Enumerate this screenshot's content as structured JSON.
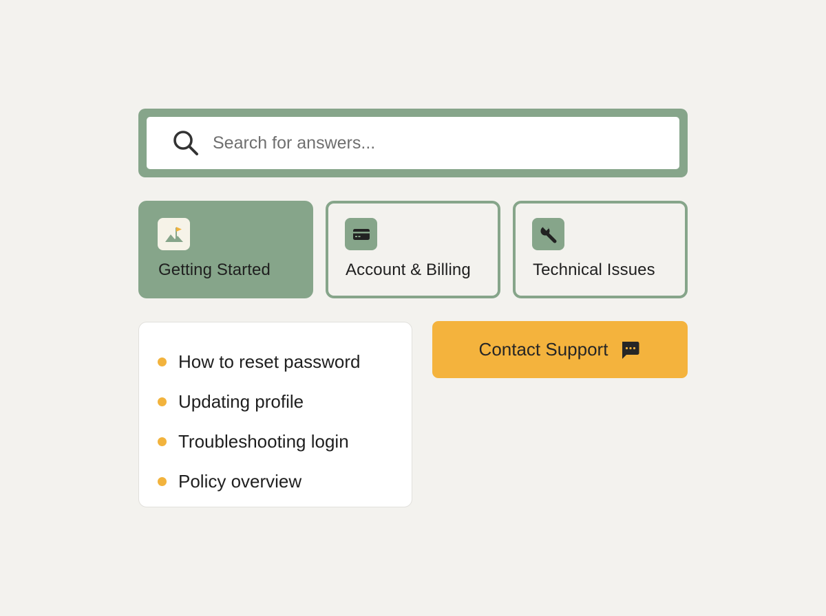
{
  "search": {
    "placeholder": "Search for answers...",
    "icon": "search-icon"
  },
  "categories": [
    {
      "label": "Getting Started",
      "icon": "flag-icon",
      "active": true
    },
    {
      "label": "Account & Billing",
      "icon": "credit-card-icon",
      "active": false
    },
    {
      "label": "Technical Issues",
      "icon": "wrench-icon",
      "active": false
    }
  ],
  "articles": [
    {
      "label": "How to reset password"
    },
    {
      "label": "Updating profile"
    },
    {
      "label": "Troubleshooting login"
    },
    {
      "label": "Policy overview"
    }
  ],
  "contact": {
    "label": "Contact Support",
    "icon": "chat-bubble-icon"
  },
  "colors": {
    "background": "#f3f2ee",
    "accent_green": "#86a58a",
    "accent_yellow": "#f4b33d",
    "text": "#1f1f1f"
  }
}
